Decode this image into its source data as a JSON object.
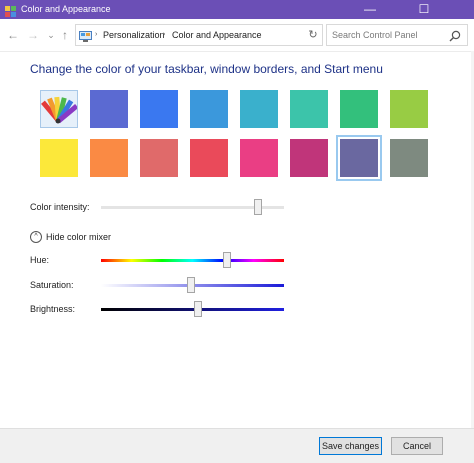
{
  "window": {
    "title": "Color and Appearance",
    "controls": {
      "minimize": "—",
      "maximize": "☐"
    }
  },
  "nav": {
    "back": "←",
    "forward": "→",
    "dropdown": "⌄",
    "up": "↑"
  },
  "address": {
    "crumbs": [
      "Personalization",
      "Color and Appearance"
    ],
    "separator": "›",
    "refresh": "↻"
  },
  "search": {
    "placeholder": "Search Control Panel"
  },
  "heading": "Change the color of your taskbar, window borders, and Start menu",
  "swatches": {
    "row1": [
      "auto",
      "#5b6ad2",
      "#3a78f0",
      "#3b98dc",
      "#3ab0cc",
      "#3cc4aa",
      "#33c07c",
      "#98cc44"
    ],
    "row2": [
      "#fce83a",
      "#fa8a44",
      "#e06a6a",
      "#ea4a5a",
      "#ea3e84",
      "#c0357a",
      "#6a68a0",
      "#7e8a80"
    ],
    "selected": "#6a68a0"
  },
  "intensity": {
    "label": "Color intensity:",
    "value": 0.86
  },
  "mixer": {
    "toggle_label": "Hide color mixer",
    "toggle_icon": "^"
  },
  "sliders": {
    "hue": {
      "label": "Hue:",
      "value": 0.69
    },
    "saturation": {
      "label": "Saturation:",
      "value": 0.49
    },
    "brightness": {
      "label": "Brightness:",
      "value": 0.53
    }
  },
  "buttons": {
    "save": "Save changes",
    "cancel": "Cancel"
  }
}
